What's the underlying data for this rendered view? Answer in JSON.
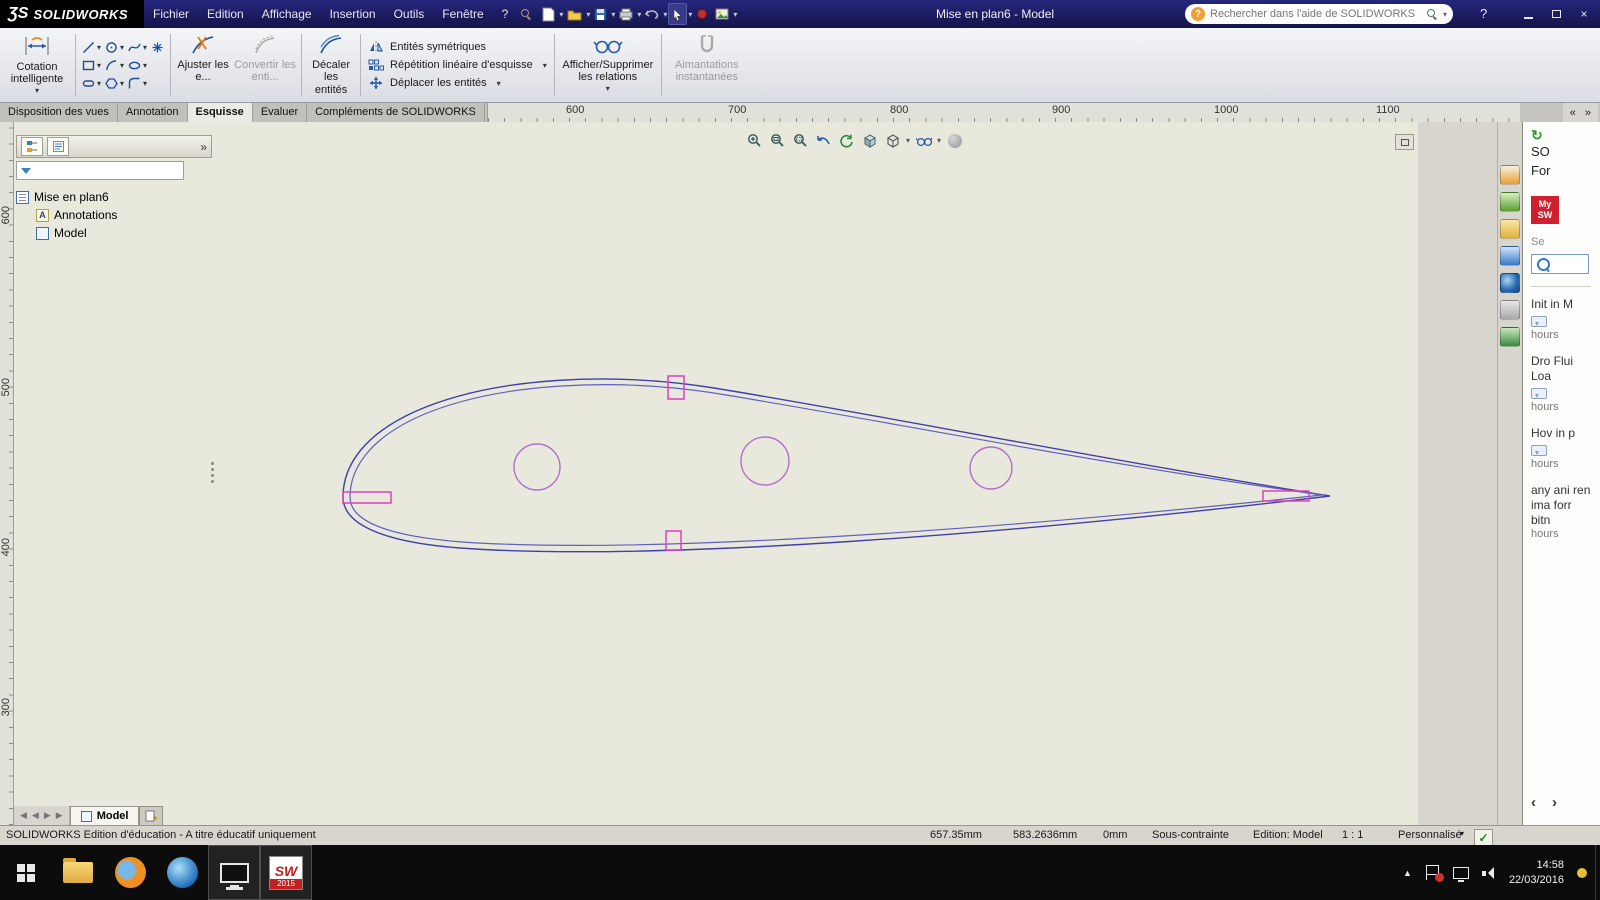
{
  "icons": {
    "caret": "▾",
    "chevrons_collapse": "«",
    "chevrons_expand": "»",
    "expand": "»",
    "nav_first": "◀",
    "nav_prev": "◀",
    "nav_next": "▶",
    "nav_last": "▶",
    "help": "?",
    "close": "×",
    "check": "✓",
    "tray_up": "▲",
    "refresh": "↻",
    "annotations_glyph": "A",
    "pane_prev": "‹",
    "pane_next": "›"
  },
  "titlebar": {
    "logo_mark": "ƷS",
    "logo": "SOLIDWORKS",
    "menus": [
      "Fichier",
      "Edition",
      "Affichage",
      "Insertion",
      "Outils",
      "Fenêtre",
      "?"
    ],
    "doc_title": "Mise en plan6 - Model",
    "search_placeholder": "Rechercher dans l'aide de SOLIDWORKS"
  },
  "ribbon": {
    "smart_dimension": "Cotation intelligente",
    "trim_entities": "Ajuster les e...",
    "convert_entities": "Convertir les enti...",
    "offset_entities": "Décaler les entités",
    "mirror_entities": "Entités symétriques",
    "linear_pattern": "Répétition linéaire d'esquisse",
    "move_entities": "Déplacer les entités",
    "display_relations": "Afficher/Supprimer les relations",
    "instant_snaps": "Aimantations instantanées"
  },
  "tabs": [
    "Disposition des vues",
    "Annotation",
    "Esquisse",
    "Evaluer",
    "Compléments de SOLIDWORKS"
  ],
  "rulers": {
    "horizontal": [
      "600",
      "700",
      "800",
      "900",
      "1000",
      "1100"
    ],
    "vertical": [
      "600",
      "500",
      "400",
      "300"
    ]
  },
  "feature_tree": {
    "root": "Mise en plan6",
    "children": [
      "Annotations",
      "Model"
    ]
  },
  "sheet_bar": {
    "model_tab": "Model"
  },
  "statusbar": {
    "message": "SOLIDWORKS Edition d'éducation - A titre éducatif uniquement",
    "x": "657.35mm",
    "y": "583.2636mm",
    "z": "0mm",
    "state": "Sous-contrainte",
    "edition": "Edition: Model",
    "scale": "1 : 1",
    "custom": "Personnalisé"
  },
  "taskpane": {
    "header_top": "SO",
    "header_bottom": "For",
    "badge_top": "My",
    "badge_bottom": "SW",
    "search_hint": "Se",
    "items": [
      {
        "title": "Init in M",
        "meta": "hours"
      },
      {
        "title": "Dro Flui Loa",
        "meta": "hours"
      },
      {
        "title": "Hov in p",
        "meta": "hours"
      },
      {
        "title": "any ani ren ima forr bitn",
        "meta": "hours"
      }
    ]
  },
  "taskbar": {
    "time": "14:58",
    "date": "22/03/2016",
    "sw_label": "SW",
    "sw_year": "2015"
  }
}
